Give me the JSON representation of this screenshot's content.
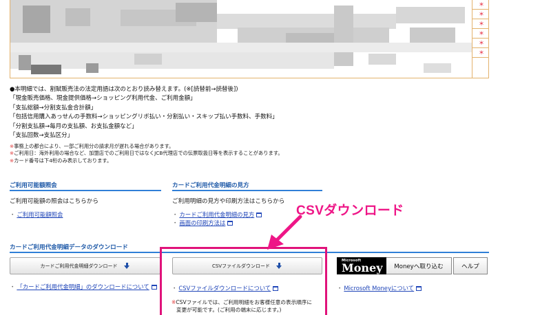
{
  "statement": {
    "markers": [
      "＊",
      "＊",
      "＊",
      "＊",
      "＊",
      "＊",
      "＊２"
    ]
  },
  "notes": {
    "heading": "●本明細では、割賦販売法の法定用語は次のとおり読み替えます。(※[読替前→読替後])",
    "lines": [
      "「現金販売価格、現金提供価格→ショッピング利用代金、ご利用金額」",
      "「支払総額→分割支払金合計額」",
      "「包括信用購入あっせんの手数料→ショッピングリボ払い・分割払い・スキップ払い手数料、手数料」",
      "「分割支払額→毎月の支払額、お支払金額など」",
      "「支払回数→支払区分」"
    ]
  },
  "fine_print": {
    "mark": "※",
    "lines": [
      "事務上の都合により、一部ご利用分の請求月が遅れる場合があります。",
      "ご利用日：海外利用の場合など、加盟店でのご利用日ではなくJCB代理店での伝票取扱日等を表示することがあります。",
      "カード番号は下4桁のみ表示しております。"
    ]
  },
  "section_available": {
    "title": "ご利用可能額照会",
    "description": "ご利用可能額の照会はこちらから",
    "link": "ご利用可能額照会"
  },
  "section_howto": {
    "title": "カードご利用代金明細の見方",
    "description": "ご利用明細の見方や印刷方法はこちらから",
    "links": [
      "カードご利用代金明細の見方",
      "画面の印刷方法は"
    ]
  },
  "section_download": {
    "title": "カードご利用代金明細データのダウンロード",
    "buttons": {
      "card_statement": "カードご利用代金明細ダウンロード",
      "csv": "CSVファイルダウンロード"
    },
    "money": {
      "logo_small": "Microsoft",
      "logo_big": "Money",
      "import_label": "Moneyへ取り込む",
      "help_label": "ヘルプ"
    },
    "links": {
      "card_about": "「カードご利用代金明細」のダウンロードについて",
      "csv_about": "CSVファイルダウンロードについて",
      "money_about": "Microsoft Moneyについて"
    },
    "csv_note_mark": "※",
    "csv_note": [
      "CSVファイルでは、ご利用明細をお客様任意の表示順序に",
      "変更が可能です。(ご利用の端末に応じます。)"
    ]
  },
  "annotation": {
    "label": "CSVダウンロード",
    "color": "#ee1687"
  }
}
